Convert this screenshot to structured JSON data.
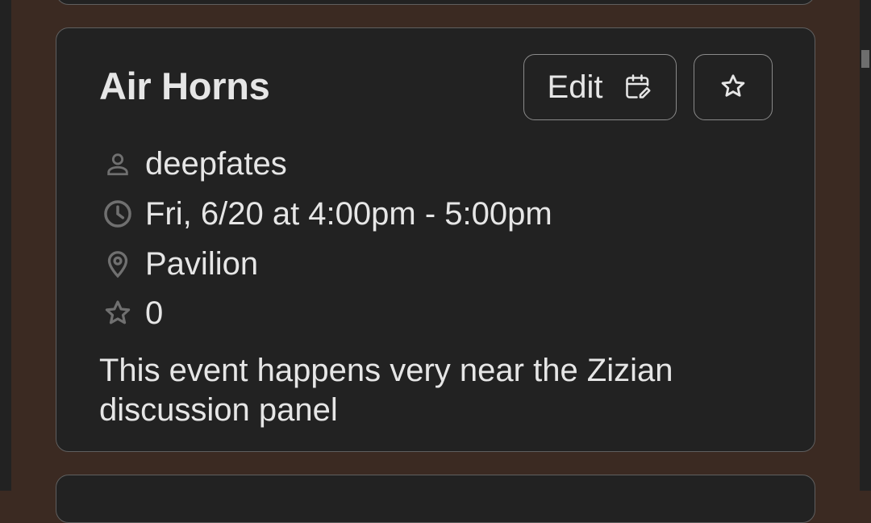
{
  "event": {
    "title": "Air Horns",
    "host": "deepfates",
    "time": "Fri, 6/20 at 4:00pm - 5:00pm",
    "location": "Pavilion",
    "star_count": "0",
    "description": "This event happens very near the Zizian discussion panel"
  },
  "actions": {
    "edit_label": "Edit",
    "edit_icon": "calendar-edit-icon",
    "star_icon": "star-outline-icon"
  },
  "icons": {
    "host": "person-icon",
    "time": "clock-icon",
    "location": "location-pin-icon",
    "stars": "star-outline-icon"
  },
  "colors": {
    "background": "#3b2a22",
    "card": "#222222",
    "text": "#e6e6e6",
    "muted_icon": "#707070"
  }
}
